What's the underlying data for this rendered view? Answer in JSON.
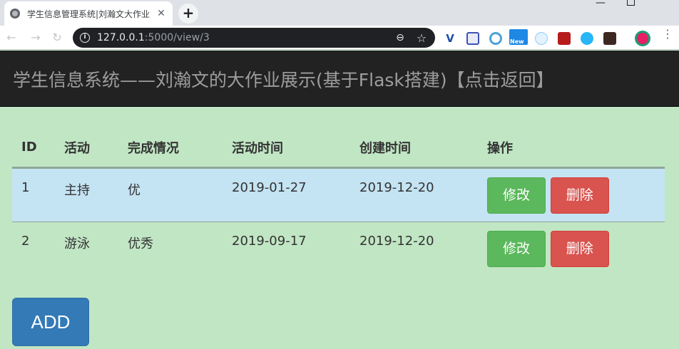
{
  "browser": {
    "tab_title": "学生信息管理系统|刘瀚文大作业",
    "url_host": "127.0.0.1",
    "url_rest": ":5000/view/3",
    "extension_badge_new": "New"
  },
  "header": {
    "brand": "学生信息系统——刘瀚文的大作业展示(基于Flask搭建)【点击返回】"
  },
  "table": {
    "columns": [
      "ID",
      "活动",
      "完成情况",
      "活动时间",
      "创建时间",
      "操作"
    ],
    "rows": [
      {
        "id": "1",
        "activity": "主持",
        "status": "优",
        "activity_time": "2019-01-27",
        "created_time": "2019-12-20"
      },
      {
        "id": "2",
        "activity": "游泳",
        "status": "优秀",
        "activity_time": "2019-09-17",
        "created_time": "2019-12-20"
      }
    ],
    "edit_label": "修改",
    "delete_label": "删除"
  },
  "add_label": "ADD",
  "colors": {
    "page_bg": "#c1e6c4",
    "navbar_bg": "#222222",
    "row_highlight": "#c4e3f3",
    "edit_button": "#5cb85c",
    "delete_button": "#d9534f",
    "add_button": "#337ab7"
  }
}
